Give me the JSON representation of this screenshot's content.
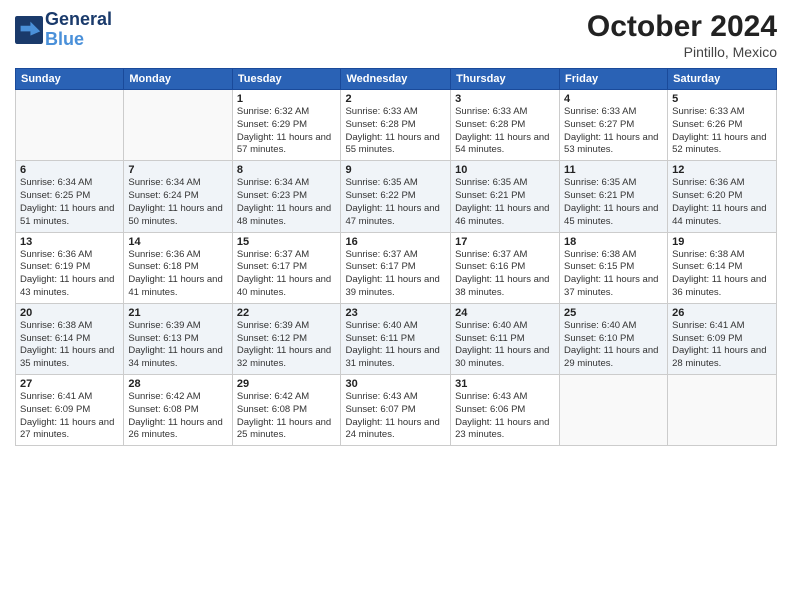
{
  "logo": {
    "line1": "General",
    "line2": "Blue"
  },
  "title": "October 2024",
  "subtitle": "Pintillo, Mexico",
  "weekdays": [
    "Sunday",
    "Monday",
    "Tuesday",
    "Wednesday",
    "Thursday",
    "Friday",
    "Saturday"
  ],
  "weeks": [
    [
      {
        "day": "",
        "info": ""
      },
      {
        "day": "",
        "info": ""
      },
      {
        "day": "1",
        "info": "Sunrise: 6:32 AM\nSunset: 6:29 PM\nDaylight: 11 hours and 57 minutes."
      },
      {
        "day": "2",
        "info": "Sunrise: 6:33 AM\nSunset: 6:28 PM\nDaylight: 11 hours and 55 minutes."
      },
      {
        "day": "3",
        "info": "Sunrise: 6:33 AM\nSunset: 6:28 PM\nDaylight: 11 hours and 54 minutes."
      },
      {
        "day": "4",
        "info": "Sunrise: 6:33 AM\nSunset: 6:27 PM\nDaylight: 11 hours and 53 minutes."
      },
      {
        "day": "5",
        "info": "Sunrise: 6:33 AM\nSunset: 6:26 PM\nDaylight: 11 hours and 52 minutes."
      }
    ],
    [
      {
        "day": "6",
        "info": "Sunrise: 6:34 AM\nSunset: 6:25 PM\nDaylight: 11 hours and 51 minutes."
      },
      {
        "day": "7",
        "info": "Sunrise: 6:34 AM\nSunset: 6:24 PM\nDaylight: 11 hours and 50 minutes."
      },
      {
        "day": "8",
        "info": "Sunrise: 6:34 AM\nSunset: 6:23 PM\nDaylight: 11 hours and 48 minutes."
      },
      {
        "day": "9",
        "info": "Sunrise: 6:35 AM\nSunset: 6:22 PM\nDaylight: 11 hours and 47 minutes."
      },
      {
        "day": "10",
        "info": "Sunrise: 6:35 AM\nSunset: 6:21 PM\nDaylight: 11 hours and 46 minutes."
      },
      {
        "day": "11",
        "info": "Sunrise: 6:35 AM\nSunset: 6:21 PM\nDaylight: 11 hours and 45 minutes."
      },
      {
        "day": "12",
        "info": "Sunrise: 6:36 AM\nSunset: 6:20 PM\nDaylight: 11 hours and 44 minutes."
      }
    ],
    [
      {
        "day": "13",
        "info": "Sunrise: 6:36 AM\nSunset: 6:19 PM\nDaylight: 11 hours and 43 minutes."
      },
      {
        "day": "14",
        "info": "Sunrise: 6:36 AM\nSunset: 6:18 PM\nDaylight: 11 hours and 41 minutes."
      },
      {
        "day": "15",
        "info": "Sunrise: 6:37 AM\nSunset: 6:17 PM\nDaylight: 11 hours and 40 minutes."
      },
      {
        "day": "16",
        "info": "Sunrise: 6:37 AM\nSunset: 6:17 PM\nDaylight: 11 hours and 39 minutes."
      },
      {
        "day": "17",
        "info": "Sunrise: 6:37 AM\nSunset: 6:16 PM\nDaylight: 11 hours and 38 minutes."
      },
      {
        "day": "18",
        "info": "Sunrise: 6:38 AM\nSunset: 6:15 PM\nDaylight: 11 hours and 37 minutes."
      },
      {
        "day": "19",
        "info": "Sunrise: 6:38 AM\nSunset: 6:14 PM\nDaylight: 11 hours and 36 minutes."
      }
    ],
    [
      {
        "day": "20",
        "info": "Sunrise: 6:38 AM\nSunset: 6:14 PM\nDaylight: 11 hours and 35 minutes."
      },
      {
        "day": "21",
        "info": "Sunrise: 6:39 AM\nSunset: 6:13 PM\nDaylight: 11 hours and 34 minutes."
      },
      {
        "day": "22",
        "info": "Sunrise: 6:39 AM\nSunset: 6:12 PM\nDaylight: 11 hours and 32 minutes."
      },
      {
        "day": "23",
        "info": "Sunrise: 6:40 AM\nSunset: 6:11 PM\nDaylight: 11 hours and 31 minutes."
      },
      {
        "day": "24",
        "info": "Sunrise: 6:40 AM\nSunset: 6:11 PM\nDaylight: 11 hours and 30 minutes."
      },
      {
        "day": "25",
        "info": "Sunrise: 6:40 AM\nSunset: 6:10 PM\nDaylight: 11 hours and 29 minutes."
      },
      {
        "day": "26",
        "info": "Sunrise: 6:41 AM\nSunset: 6:09 PM\nDaylight: 11 hours and 28 minutes."
      }
    ],
    [
      {
        "day": "27",
        "info": "Sunrise: 6:41 AM\nSunset: 6:09 PM\nDaylight: 11 hours and 27 minutes."
      },
      {
        "day": "28",
        "info": "Sunrise: 6:42 AM\nSunset: 6:08 PM\nDaylight: 11 hours and 26 minutes."
      },
      {
        "day": "29",
        "info": "Sunrise: 6:42 AM\nSunset: 6:08 PM\nDaylight: 11 hours and 25 minutes."
      },
      {
        "day": "30",
        "info": "Sunrise: 6:43 AM\nSunset: 6:07 PM\nDaylight: 11 hours and 24 minutes."
      },
      {
        "day": "31",
        "info": "Sunrise: 6:43 AM\nSunset: 6:06 PM\nDaylight: 11 hours and 23 minutes."
      },
      {
        "day": "",
        "info": ""
      },
      {
        "day": "",
        "info": ""
      }
    ]
  ]
}
